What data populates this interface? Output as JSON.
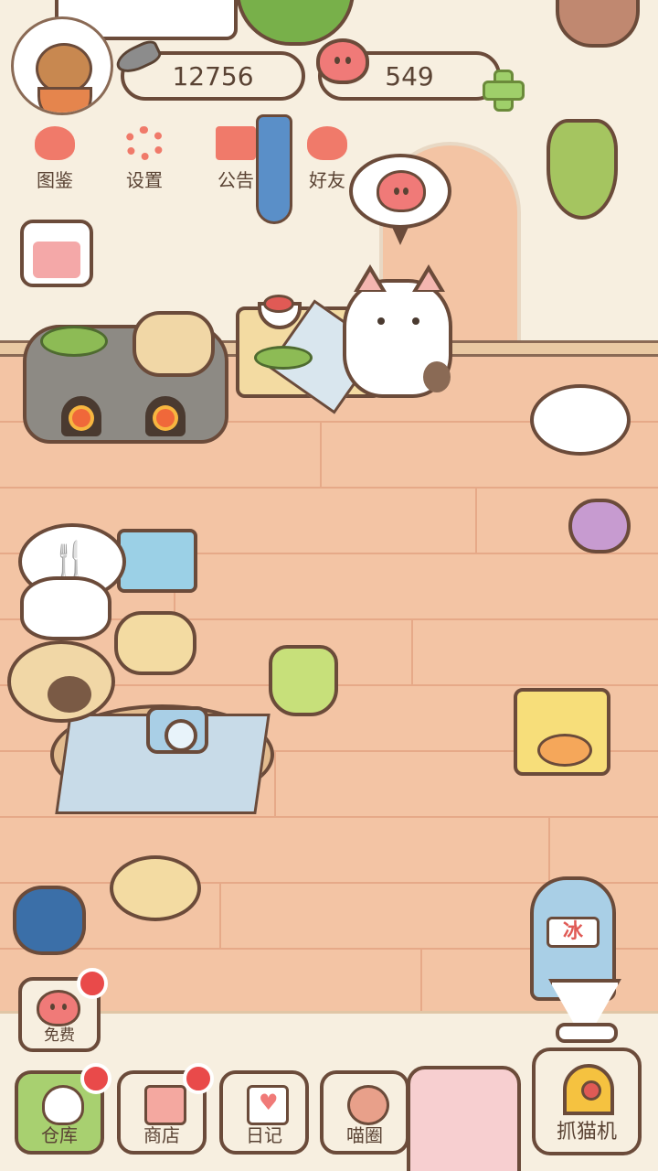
{
  "hud": {
    "fish_count": "12756",
    "heart_count": "549",
    "icons": {
      "currency_fish": "fish-icon",
      "currency_heart": "heart-icon",
      "add": "plus-icon"
    }
  },
  "top_menu": [
    {
      "label": "图鉴",
      "icon": "cat-book-icon"
    },
    {
      "label": "设置",
      "icon": "gear-icon"
    },
    {
      "label": "公告",
      "icon": "gift-icon"
    },
    {
      "label": "好友",
      "icon": "friends-icon"
    }
  ],
  "free_button": {
    "label": "免费"
  },
  "ice_machine": {
    "sign": "冰"
  },
  "bottom_nav": [
    {
      "label": "仓库",
      "icon": "warehouse-icon",
      "active": true,
      "badge": true
    },
    {
      "label": "商店",
      "icon": "shop-icon",
      "active": false,
      "badge": true
    },
    {
      "label": "日记",
      "icon": "diary-icon",
      "active": false,
      "badge": false
    },
    {
      "label": "喵圈",
      "icon": "cat-planet-icon",
      "active": false,
      "badge": false
    }
  ],
  "claw_machine": {
    "label": "抓猫机"
  },
  "colors": {
    "wall": "#f7efe0",
    "floor": "#f3c4a4",
    "outline": "#6b4b3a",
    "accent_green": "#a8d070",
    "badge_red": "#e94a4a",
    "heart_pink": "#f07a78"
  }
}
